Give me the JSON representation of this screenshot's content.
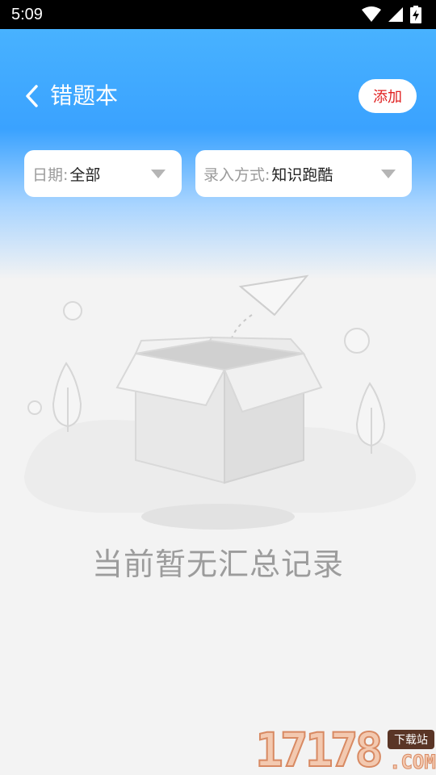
{
  "status_bar": {
    "time": "5:09",
    "icons": [
      "wifi-icon",
      "signal-icon",
      "battery-charging-icon"
    ]
  },
  "nav": {
    "back_icon": "chevron-left-icon",
    "title": "错题本",
    "add_label": "添加"
  },
  "filters": {
    "date_label": "日期:",
    "date_value": "全部",
    "method_label": "录入方式:",
    "method_value": "知识跑酷",
    "caret_icon": "caret-down-icon"
  },
  "empty_state": {
    "illustration": "empty-box-illustration",
    "message": "当前暂无汇总记录"
  },
  "watermark": {
    "digits": "17178",
    "badge": "下载站",
    "domain": ".COM"
  },
  "colors": {
    "header_blue": "#3aa2ff",
    "add_text": "#e02020",
    "empty_text": "#9c9c9c"
  }
}
